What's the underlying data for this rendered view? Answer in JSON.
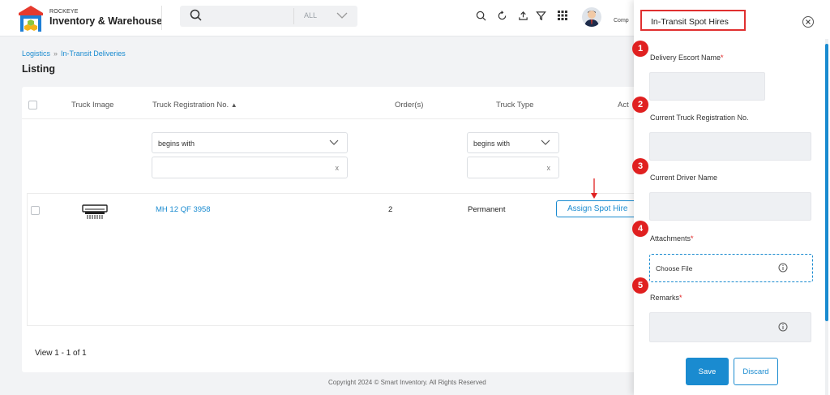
{
  "brand": {
    "small": "ROCKEYE",
    "name": "Inventory & Warehouse"
  },
  "search": {
    "scope": "ALL"
  },
  "header": {
    "user_label": "Comp"
  },
  "breadcrumb": {
    "items": [
      "Logistics",
      "In-Transit Deliveries"
    ]
  },
  "page": {
    "title": "Listing"
  },
  "table": {
    "columns": [
      "Truck Image",
      "Truck Registration No.",
      "Order(s)",
      "Truck Type",
      "Act"
    ],
    "filters": {
      "registration_operator": "begins with",
      "type_operator": "begins with",
      "clear": "x"
    },
    "rows": [
      {
        "registration": "MH 12 QF 3958",
        "orders": "2",
        "type": "Permanent",
        "action": "Assign Spot Hire"
      }
    ],
    "view_count": "View 1 - 1 of 1"
  },
  "footer": {
    "text": "Copyright 2024 © Smart Inventory. All Rights Reserved"
  },
  "panel": {
    "title": "In-Transit Spot Hires",
    "fields": [
      {
        "step": "1",
        "label": "Delivery Escort Name",
        "required": "*"
      },
      {
        "step": "2",
        "label": "Current Truck Registration No."
      },
      {
        "step": "3",
        "label": "Current Driver Name"
      },
      {
        "step": "4",
        "label": "Attachments",
        "required": "*",
        "file_text": "Choose File"
      },
      {
        "step": "5",
        "label": "Remarks",
        "required": "*"
      }
    ],
    "save": "Save",
    "discard": "Discard"
  },
  "colors": {
    "accent": "#1a8bd0",
    "marker": "#e02020",
    "highlight_border": "#e03030"
  }
}
